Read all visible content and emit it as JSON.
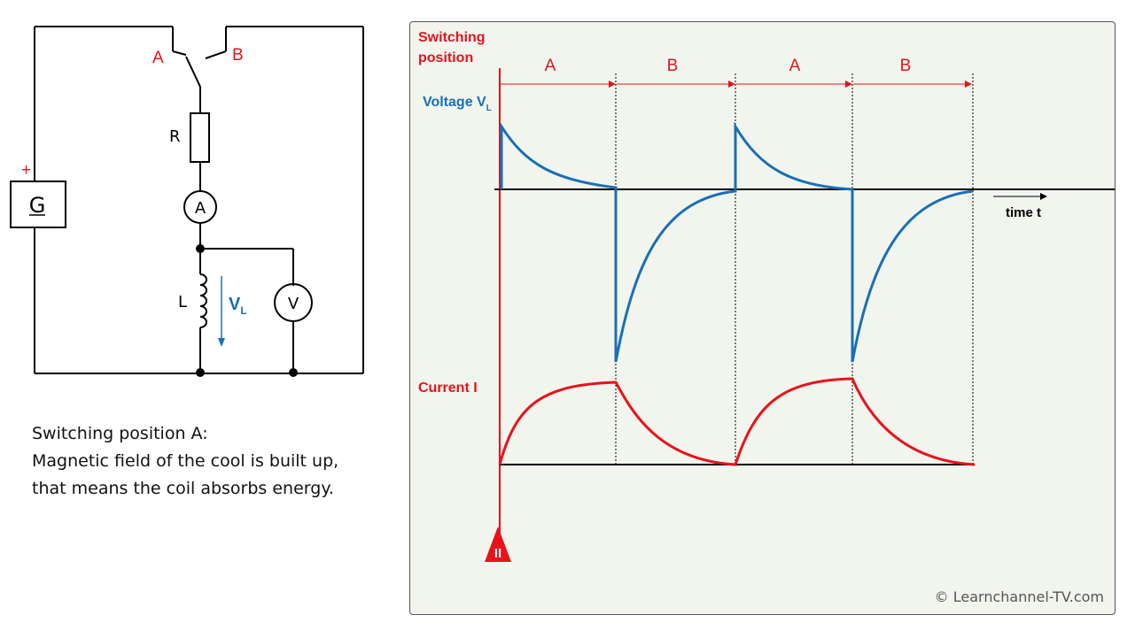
{
  "circuit": {
    "switch_a": "A",
    "switch_b": "B",
    "resistor": "R",
    "ammeter": "A",
    "inductor": "L",
    "voltmeter": "V",
    "generator": "G",
    "plus": "+",
    "voltage_label_main": "V",
    "voltage_label_sub": "L"
  },
  "description": {
    "title": "Switching position A:",
    "line1": "Magnetic field of the cool is built up,",
    "line2": "that means the coil absorbs energy."
  },
  "graph": {
    "switching_label_1": "Switching",
    "switching_label_2": "position",
    "positions": [
      "A",
      "B",
      "A",
      "B"
    ],
    "voltage_label_main": "Voltage V",
    "voltage_label_sub": "L",
    "current_label": "Current I",
    "time_label": "time t",
    "marker": "II"
  },
  "colors": {
    "voltage": "#1a6fb5",
    "current": "#e8121b",
    "panel_bg": "#f1f5ee"
  },
  "copyright": "© Learnchannel-TV.com"
}
